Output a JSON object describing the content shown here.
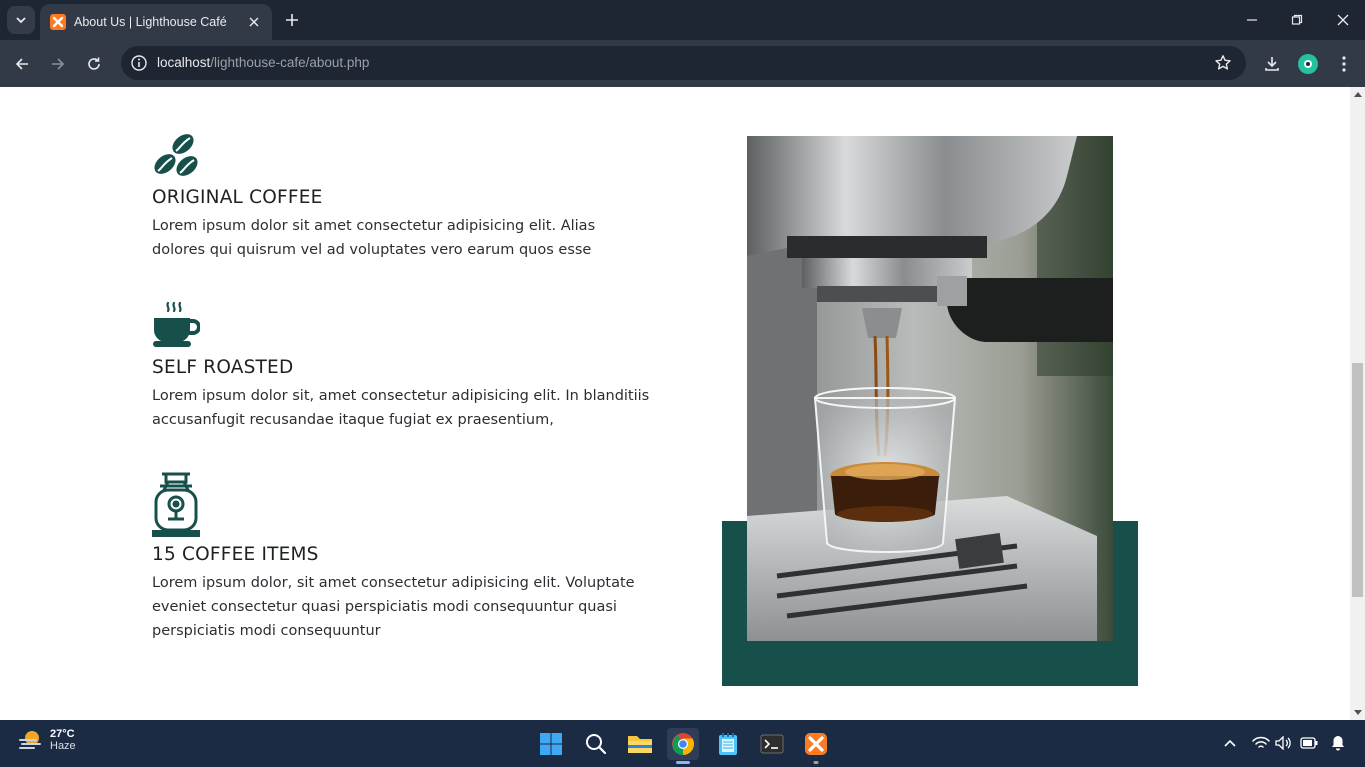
{
  "browser": {
    "tab_title": "About Us | Lighthouse Café",
    "url_host": "localhost",
    "url_path": "/lighthouse-cafe/about.php"
  },
  "features": [
    {
      "icon": "coffee-beans-icon",
      "title": "ORIGINAL COFFEE",
      "text": "Lorem ipsum dolor sit amet consectetur adipisicing elit. Alias dolores qui quisrum vel ad voluptates vero earum quos esse"
    },
    {
      "icon": "coffee-cup-icon",
      "title": "SELF ROASTED",
      "text": "Lorem ipsum dolor sit, amet consectetur adipisicing elit. In blanditiis accusanfugit recusandae itaque fugiat ex praesentium,"
    },
    {
      "icon": "coffee-grinder-icon",
      "title": "15 COFFEE ITEMS",
      "text": "Lorem ipsum dolor, sit amet consectetur adipisicing elit. Voluptate eveniet consectetur quasi perspiciatis modi consequuntur quasi perspiciatis modi consequuntur"
    }
  ],
  "colors": {
    "accent": "#17504a",
    "icon": "#17504a"
  },
  "taskbar": {
    "temperature": "27°C",
    "condition": "Haze"
  }
}
